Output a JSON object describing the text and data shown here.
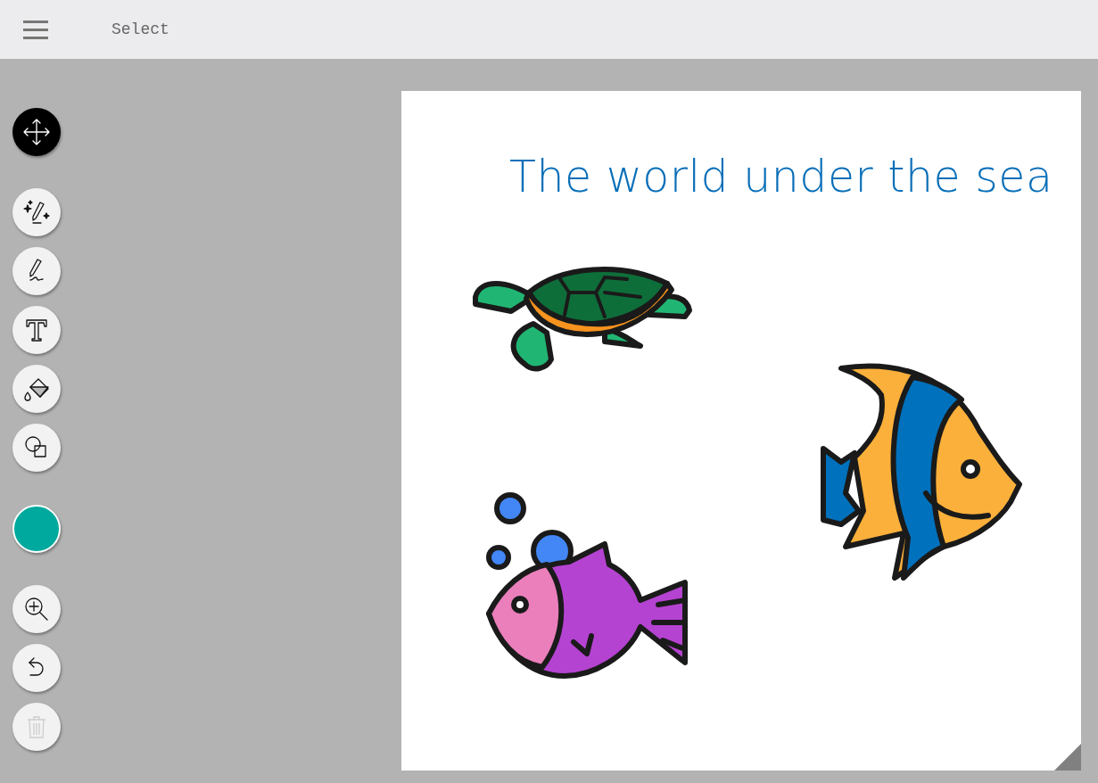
{
  "top_bar": {
    "mode_label": "Select"
  },
  "tools": [
    {
      "kind": "move",
      "selected": true
    },
    {
      "kind": "magic-pen",
      "selected": false
    },
    {
      "kind": "pen",
      "selected": false
    },
    {
      "kind": "text",
      "selected": false
    },
    {
      "kind": "fill",
      "selected": false
    },
    {
      "kind": "shapes",
      "selected": false
    }
  ],
  "color_swatch": {
    "color": "#00a99d"
  },
  "actions": [
    {
      "kind": "zoom",
      "disabled": false
    },
    {
      "kind": "undo",
      "disabled": false
    },
    {
      "kind": "delete",
      "disabled": true
    }
  ],
  "canvas": {
    "title": "The world under the sea"
  }
}
